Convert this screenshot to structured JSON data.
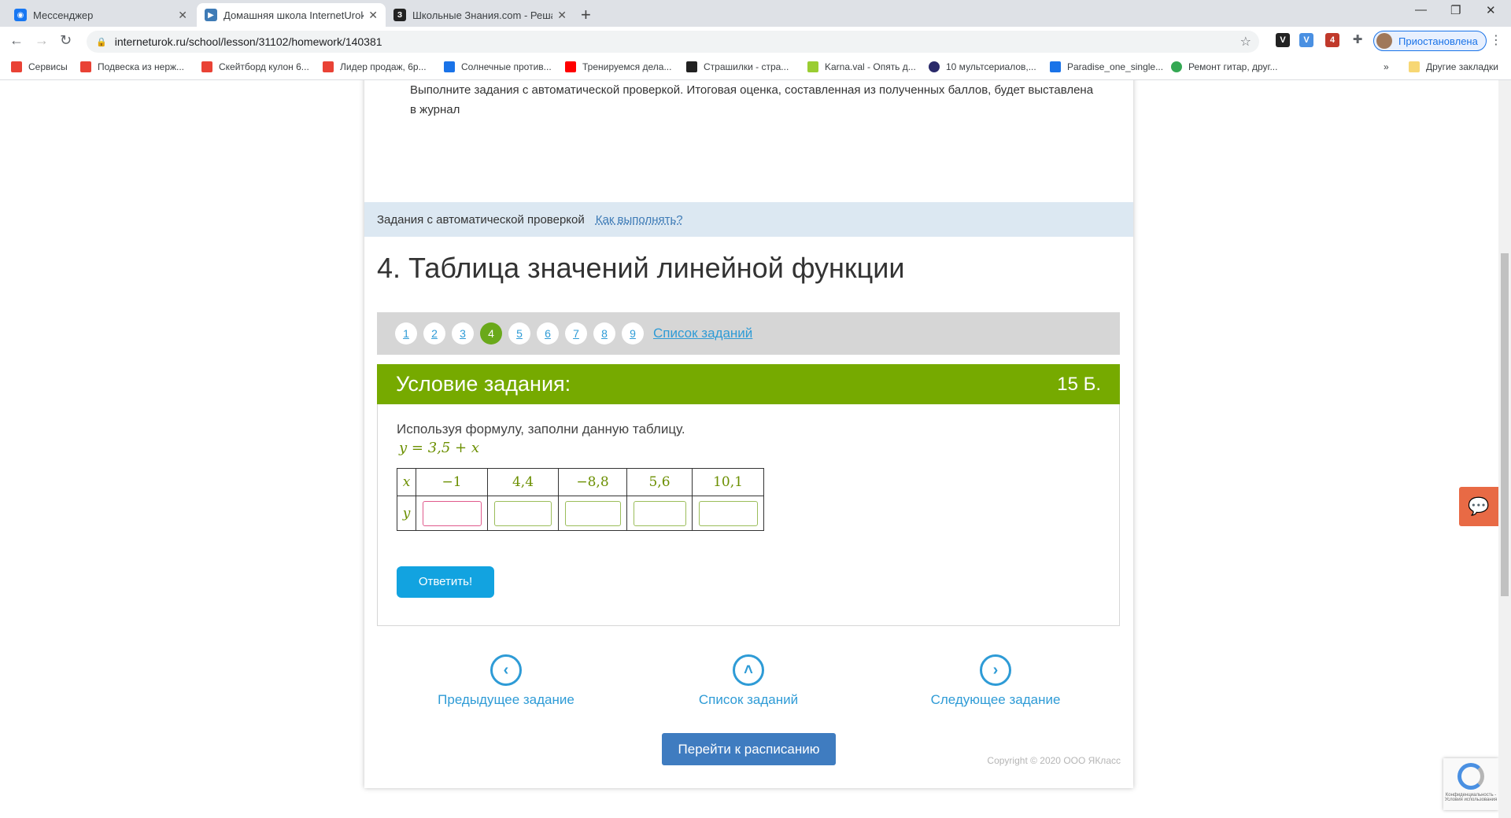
{
  "browser": {
    "tabs": [
      {
        "title": "Мессенджер",
        "icon": "messenger-icon",
        "color": "#1877f2"
      },
      {
        "title": "Домашняя школа InternetUrok.r",
        "icon": "internetUrok-icon",
        "color": "#3e7bb6"
      },
      {
        "title": "Школьные Знания.com - Решае",
        "icon": "znania-icon",
        "color": "#222222"
      }
    ],
    "url": "interneturok.ru/school/lesson/31102/homework/140381",
    "profile_label": "Приостановлена",
    "bookmarks": [
      {
        "label": "Сервисы",
        "color": "#e94235"
      },
      {
        "label": "Подвеска из нерж...",
        "color": "#e94235"
      },
      {
        "label": "Скейтборд кулон 6...",
        "color": "#e94235"
      },
      {
        "label": "Лидер продаж, 6р...",
        "color": "#e94235"
      },
      {
        "label": "Солнечные против...",
        "color": "#1a73e8"
      },
      {
        "label": "Тренируемся дела...",
        "color": "#ff0000"
      },
      {
        "label": "Страшилки - стра...",
        "color": "#222222"
      },
      {
        "label": "Karna.val - Опять д...",
        "color": "#9acd32"
      },
      {
        "label": "10 мультсериалов,...",
        "color": "#2a2a6a"
      },
      {
        "label": "Paradise_one_single...",
        "color": "#1a73e8"
      },
      {
        "label": "Ремонт гитар, друг...",
        "color": "#34a853"
      }
    ],
    "other_bookmarks": "Другие закладки"
  },
  "page": {
    "intro_text": "Выполните задания с автоматической проверкой. Итоговая оценка, составленная из полученных баллов, будет выставлена в журнал",
    "auto_label": "Задания с автоматической проверкой",
    "how_to_link": "Как выполнять?",
    "heading": "4. Таблица значений линейной функции",
    "pager": {
      "pages": [
        "1",
        "2",
        "3",
        "4",
        "5",
        "6",
        "7",
        "8",
        "9"
      ],
      "current": "4",
      "list_link": "Список заданий"
    },
    "task": {
      "header": "Условие задания:",
      "points": "15 Б.",
      "text": "Используя формулу, заполни данную таблицу.",
      "formula": "y = 3,5 + x",
      "row_x_label": "x",
      "row_y_label": "y",
      "x_values": [
        "−1",
        "4,4",
        "−8,8",
        "5,6",
        "10,1"
      ],
      "y_values": [
        "",
        "",
        "",
        "",
        ""
      ],
      "answer_button": "Ответить!"
    },
    "nav": {
      "prev": "Предыдущее задание",
      "list": "Список заданий",
      "next": "Следующее задание"
    },
    "copyright": "Copyright © 2020 ООО ЯКласс",
    "schedule_button": "Перейти к расписанию",
    "recaptcha_text": "Конфиденциальность - Условия использования"
  },
  "colors": {
    "accent_green": "#76aa00",
    "link_blue": "#2e9bd6",
    "answer_blue": "#12a3e0",
    "schedule_blue": "#3f7cc0"
  }
}
